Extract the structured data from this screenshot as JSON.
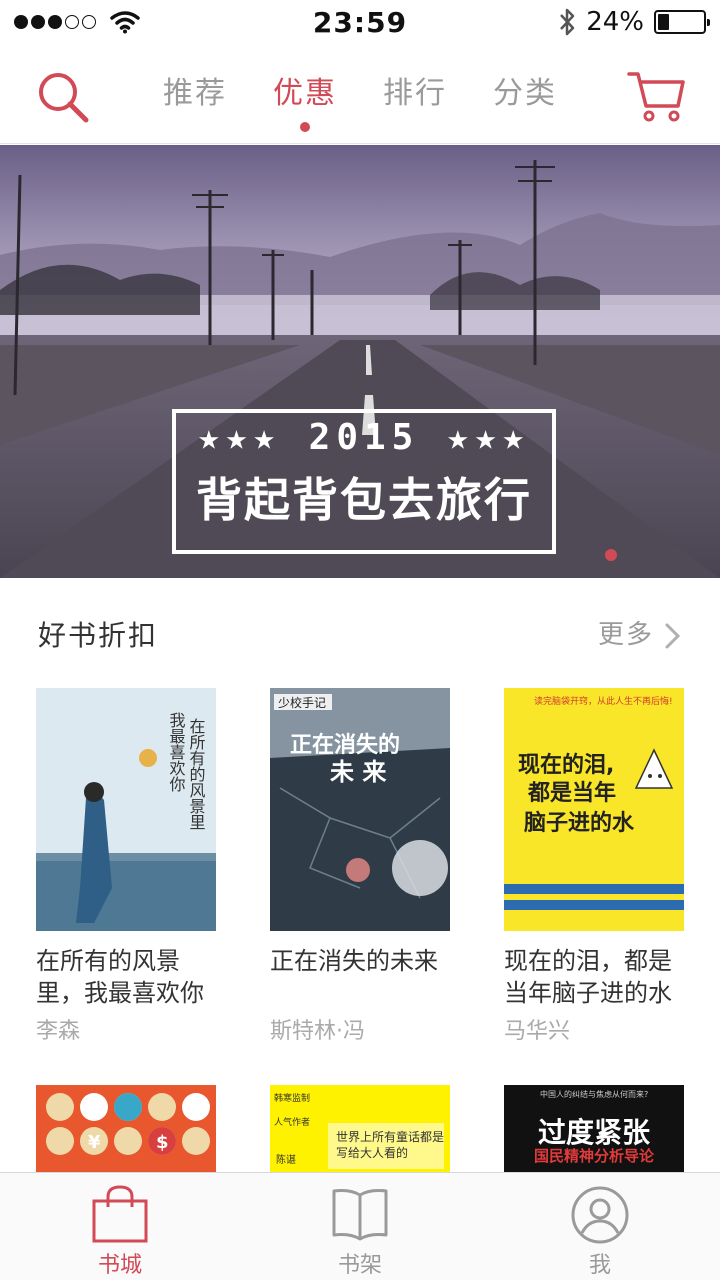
{
  "status_bar": {
    "time": "23:59",
    "battery_text": "24%",
    "battery_level": 0.24,
    "signal_bars_filled": 3,
    "signal_bars_total": 5
  },
  "top_nav": {
    "tabs": [
      {
        "label": "推荐",
        "active": false
      },
      {
        "label": "优惠",
        "active": true
      },
      {
        "label": "排行",
        "active": false
      },
      {
        "label": "分类",
        "active": false
      }
    ],
    "icons": [
      "search-icon",
      "cart-icon"
    ]
  },
  "banner": {
    "year": "★★★ 2015 ★★★",
    "slogan": "背起背包去旅行"
  },
  "section": {
    "title": "好书折扣",
    "more_label": "更多",
    "books": [
      {
        "title": "在所有的风景里，我最喜欢你",
        "author": "李森",
        "cover_text": "在所有的风景里 我最喜欢你"
      },
      {
        "title": "正在消失的未来",
        "author": "斯特林·冯",
        "cover_series": "少校手记",
        "cover_text": "正在消失的未来"
      },
      {
        "title": "现在的泪，都是当年脑子进的水",
        "author": "马华兴",
        "cover_text": "现在的泪，都是当年脑子进的水"
      }
    ],
    "second_row_covers": [
      {
        "cover_text": ""
      },
      {
        "cover_text": "世界上所有童话都是写给大人看的"
      },
      {
        "cover_text": "过度紧张",
        "cover_subtext": "国民精神分析导论"
      }
    ]
  },
  "tab_bar": {
    "items": [
      {
        "label": "书城",
        "icon": "bag-icon",
        "active": true
      },
      {
        "label": "书架",
        "icon": "book-icon",
        "active": false
      },
      {
        "label": "我",
        "icon": "user-icon",
        "active": false
      }
    ]
  },
  "colors": {
    "accent": "#d24a55",
    "inactive": "#9a9a9a"
  }
}
